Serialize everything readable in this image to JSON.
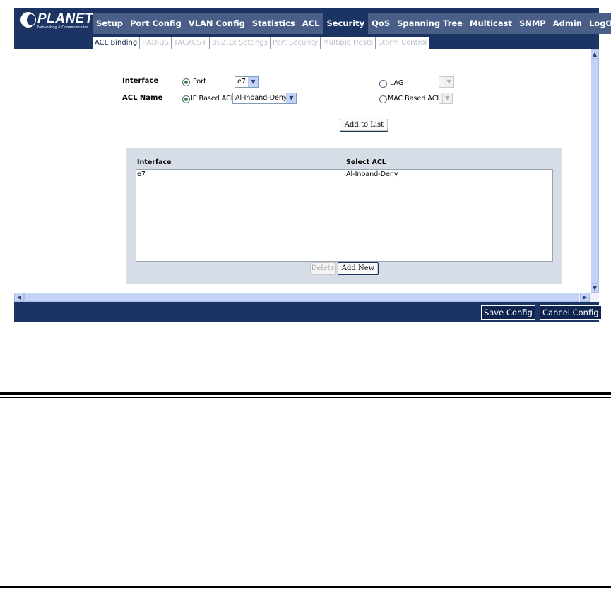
{
  "logo": {
    "brand": "PLANET",
    "tagline": "Networking & Communication"
  },
  "main_nav": [
    "Setup",
    "Port Config",
    "VLAN Config",
    "Statistics",
    "ACL",
    "Security",
    "QoS",
    "Spanning Tree",
    "Multicast",
    "SNMP",
    "Admin",
    "LogOut"
  ],
  "active_main": "Security",
  "sub_nav": [
    "ACL Binding",
    "RADIUS",
    "TACACS+",
    "802.1x Settings",
    "Port Security",
    "Multiple Hosts",
    "Storm Control"
  ],
  "active_sub": "ACL Binding",
  "form": {
    "interface_label": "Interface",
    "port_label": "Port",
    "port_value": "e7",
    "lag_label": "LAG",
    "lag_value": "",
    "acl_name_label": "ACL Name",
    "ip_acl_label": "IP Based ACL",
    "ip_acl_value": "Al-Inband-Deny",
    "mac_acl_label": "MAC Based ACL",
    "mac_acl_value": "",
    "interface_radio": "port",
    "acl_radio": "ip",
    "add_button": "Add to List"
  },
  "list": {
    "headers": [
      "Interface",
      "Select ACL"
    ],
    "rows": [
      {
        "interface": "e7",
        "acl": "Al-Inband-Deny"
      }
    ],
    "delete_button": "Delete",
    "add_new_button": "Add New"
  },
  "footer": {
    "save_label": "Save Config",
    "cancel_label": "Cancel Config"
  },
  "colors": {
    "header_bg": "#1c3463",
    "nav_bg": "#4a5f88",
    "panel_bg": "#d6dde6"
  }
}
